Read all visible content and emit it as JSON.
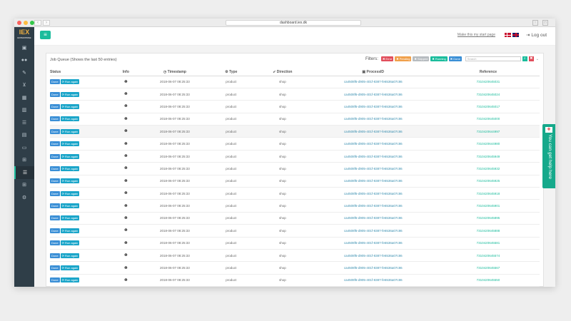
{
  "browser": {
    "url": "dashboard.iex.dk"
  },
  "brand": {
    "logo": "IEX",
    "tagline": "ENTERPRISE"
  },
  "topbar": {
    "start_page": "Make this my start page",
    "logout": "Log out"
  },
  "panel": {
    "title": "Job Queue (Shows the last 50 entries)",
    "filters_label": "Filters:",
    "filters": [
      {
        "label": "Error",
        "color": "#e14e5b"
      },
      {
        "label": "Pending",
        "color": "#f0a04b"
      },
      {
        "label": "Skipped",
        "color": "#b7bcc0"
      },
      {
        "label": "Running",
        "color": "#1abc9c"
      },
      {
        "label": "Done",
        "color": "#3a8fd6"
      }
    ],
    "search_placeholder": "Search"
  },
  "table": {
    "headers": [
      "Status",
      "Info",
      "Timestamp",
      "Type",
      "Direction",
      "ProcessID",
      "Reference"
    ],
    "rows": [
      {
        "status": "Done",
        "action": "Run again",
        "timestamp": "2018-06-07 08:25:33",
        "type": "product",
        "direction": "shop",
        "process_id": "ca4508f6-d905-401f-8387-fe6536a07c86",
        "reference": "7310420645031"
      },
      {
        "status": "Done",
        "action": "Run again",
        "timestamp": "2018-06-07 08:25:33",
        "type": "product",
        "direction": "shop",
        "process_id": "ca4508f6-d905-401f-8387-fe6536a07c86",
        "reference": "7310420645024"
      },
      {
        "status": "Done",
        "action": "Run again",
        "timestamp": "2018-06-07 08:25:33",
        "type": "product",
        "direction": "shop",
        "process_id": "ca4508f6-d905-401f-8387-fe6536a07c86",
        "reference": "7310420645017"
      },
      {
        "status": "Done",
        "action": "Run again",
        "timestamp": "2018-06-07 08:25:33",
        "type": "product",
        "direction": "shop",
        "process_id": "ca4508f6-d905-401f-8387-fe6536a07c86",
        "reference": "7310420645000"
      },
      {
        "status": "Done",
        "action": "Run again",
        "timestamp": "2018-06-07 08:25:33",
        "type": "product",
        "direction": "shop",
        "process_id": "ca4508f6-d905-401f-8387-fe6536a07c86",
        "reference": "7310420644997"
      },
      {
        "status": "Done",
        "action": "Run again",
        "timestamp": "2018-06-07 08:25:33",
        "type": "product",
        "direction": "shop",
        "process_id": "ca4508f6-d905-401f-8387-fe6536a07c86",
        "reference": "7310420644980"
      },
      {
        "status": "Done",
        "action": "Run again",
        "timestamp": "2018-06-07 08:25:33",
        "type": "product",
        "direction": "shop",
        "process_id": "ca4508f6-d905-401f-8387-fe6536a07c86",
        "reference": "7310420645949"
      },
      {
        "status": "Done",
        "action": "Run again",
        "timestamp": "2018-06-07 08:25:33",
        "type": "product",
        "direction": "shop",
        "process_id": "ca4508f6-d905-401f-8387-fe6536a07c86",
        "reference": "7310420645932"
      },
      {
        "status": "Done",
        "action": "Run again",
        "timestamp": "2018-06-07 08:25:33",
        "type": "product",
        "direction": "shop",
        "process_id": "ca4508f6-d905-401f-8387-fe6536a07c86",
        "reference": "7310420645925"
      },
      {
        "status": "Done",
        "action": "Run again",
        "timestamp": "2018-06-07 08:25:33",
        "type": "product",
        "direction": "shop",
        "process_id": "ca4508f6-d905-401f-8387-fe6536a07c86",
        "reference": "7310420645918"
      },
      {
        "status": "Done",
        "action": "Run again",
        "timestamp": "2018-06-07 08:25:33",
        "type": "product",
        "direction": "shop",
        "process_id": "ca4508f6-d905-401f-8387-fe6536a07c86",
        "reference": "7310420645901"
      },
      {
        "status": "Done",
        "action": "Run again",
        "timestamp": "2018-06-07 08:25:33",
        "type": "product",
        "direction": "shop",
        "process_id": "ca4508f6-d905-401f-8387-fe6536a07c86",
        "reference": "7310420645895"
      },
      {
        "status": "Done",
        "action": "Run again",
        "timestamp": "2018-06-07 08:25:33",
        "type": "product",
        "direction": "shop",
        "process_id": "ca4508f6-d905-401f-8387-fe6536a07c86",
        "reference": "7310420645888"
      },
      {
        "status": "Done",
        "action": "Run again",
        "timestamp": "2018-06-07 08:25:33",
        "type": "product",
        "direction": "shop",
        "process_id": "ca4508f6-d905-401f-8387-fe6536a07c86",
        "reference": "7310420645581"
      },
      {
        "status": "Done",
        "action": "Run again",
        "timestamp": "2018-06-07 08:25:33",
        "type": "product",
        "direction": "shop",
        "process_id": "ca4508f6-d905-401f-8387-fe6536a07c86",
        "reference": "7310420645574"
      },
      {
        "status": "Done",
        "action": "Run again",
        "timestamp": "2018-06-07 08:25:33",
        "type": "product",
        "direction": "shop",
        "process_id": "ca4508f6-d905-401f-8387-fe6536a07c86",
        "reference": "7310420645567"
      },
      {
        "status": "Done",
        "action": "Run again",
        "timestamp": "2018-06-07 08:25:33",
        "type": "product",
        "direction": "shop",
        "process_id": "ca4508f6-d905-401f-8387-fe6536a07c86",
        "reference": "7310420645550"
      }
    ]
  },
  "help": {
    "label": "You can get help here"
  },
  "sidebar_icons": [
    "dashboard-icon",
    "users-icon",
    "wrench-icon",
    "cart-icon",
    "calculator-icon",
    "book-icon",
    "list-icon",
    "document-icon",
    "credit-card-icon",
    "grid-icon",
    "queue-icon",
    "apps-icon",
    "settings-icon"
  ],
  "colors": {
    "sidebar": "#2f3e48",
    "accent": "#1abc9c",
    "done": "#3a8fd6",
    "run_again": "#1aa5c9"
  }
}
